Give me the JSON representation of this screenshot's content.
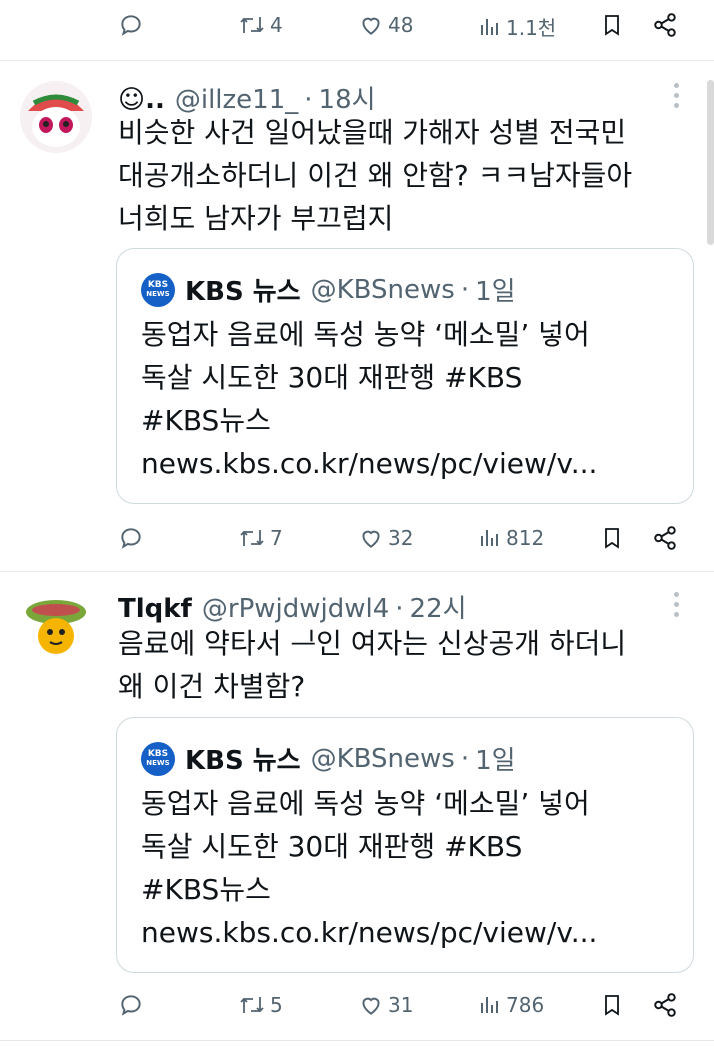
{
  "top_actions": {
    "reply": "",
    "retweet": "4",
    "like": "48",
    "views": "1.1천"
  },
  "tweets": [
    {
      "display_name": "☺..",
      "handle": "@illze11_",
      "time": "18시",
      "text_lines": [
        "비슷한 사건 일어났을때 가해자 성별 전국민",
        "대공개소하더니 이건 왜 안함? ㅋㅋ남자들아",
        "너희도 남자가 부끄럽지"
      ],
      "quote": {
        "logo_text_top": "KBS",
        "logo_text_bottom": "NEWS",
        "name": "KBS 뉴스",
        "handle": "@KBSnews",
        "time": "1일",
        "text_lines": [
          "동업자 음료에 독성 농약 ‘메소밀’ 넣어",
          "독살 시도한 30대 재판행 #KBS",
          "#KBS뉴스",
          "news.kbs.co.kr/news/pc/view/v..."
        ]
      },
      "actions": {
        "reply": "",
        "retweet": "7",
        "like": "32",
        "views": "812"
      }
    },
    {
      "display_name": "Tlqkf",
      "handle": "@rPwjdwjdwl4",
      "time": "22시",
      "text_lines": [
        "음료에 약타서 ᆜ인 여자는 신상공개 하더니",
        "왜 이건 차별함?"
      ],
      "quote": {
        "logo_text_top": "KBS",
        "logo_text_bottom": "NEWS",
        "name": "KBS 뉴스",
        "handle": "@KBSnews",
        "time": "1일",
        "text_lines": [
          "동업자 음료에 독성 농약 ‘메소밀’ 넣어",
          "독살 시도한 30대 재판행 #KBS",
          "#KBS뉴스",
          "news.kbs.co.kr/news/pc/view/v..."
        ]
      },
      "actions": {
        "reply": "",
        "retweet": "5",
        "like": "31",
        "views": "786"
      }
    }
  ],
  "colors": {
    "text": "#0f1419",
    "muted": "#536471",
    "border": "#cfd9de",
    "kbs_blue": "#1560c7"
  },
  "icons": [
    "reply-icon",
    "retweet-icon",
    "like-icon",
    "views-icon",
    "bookmark-icon",
    "share-icon",
    "more-icon"
  ]
}
